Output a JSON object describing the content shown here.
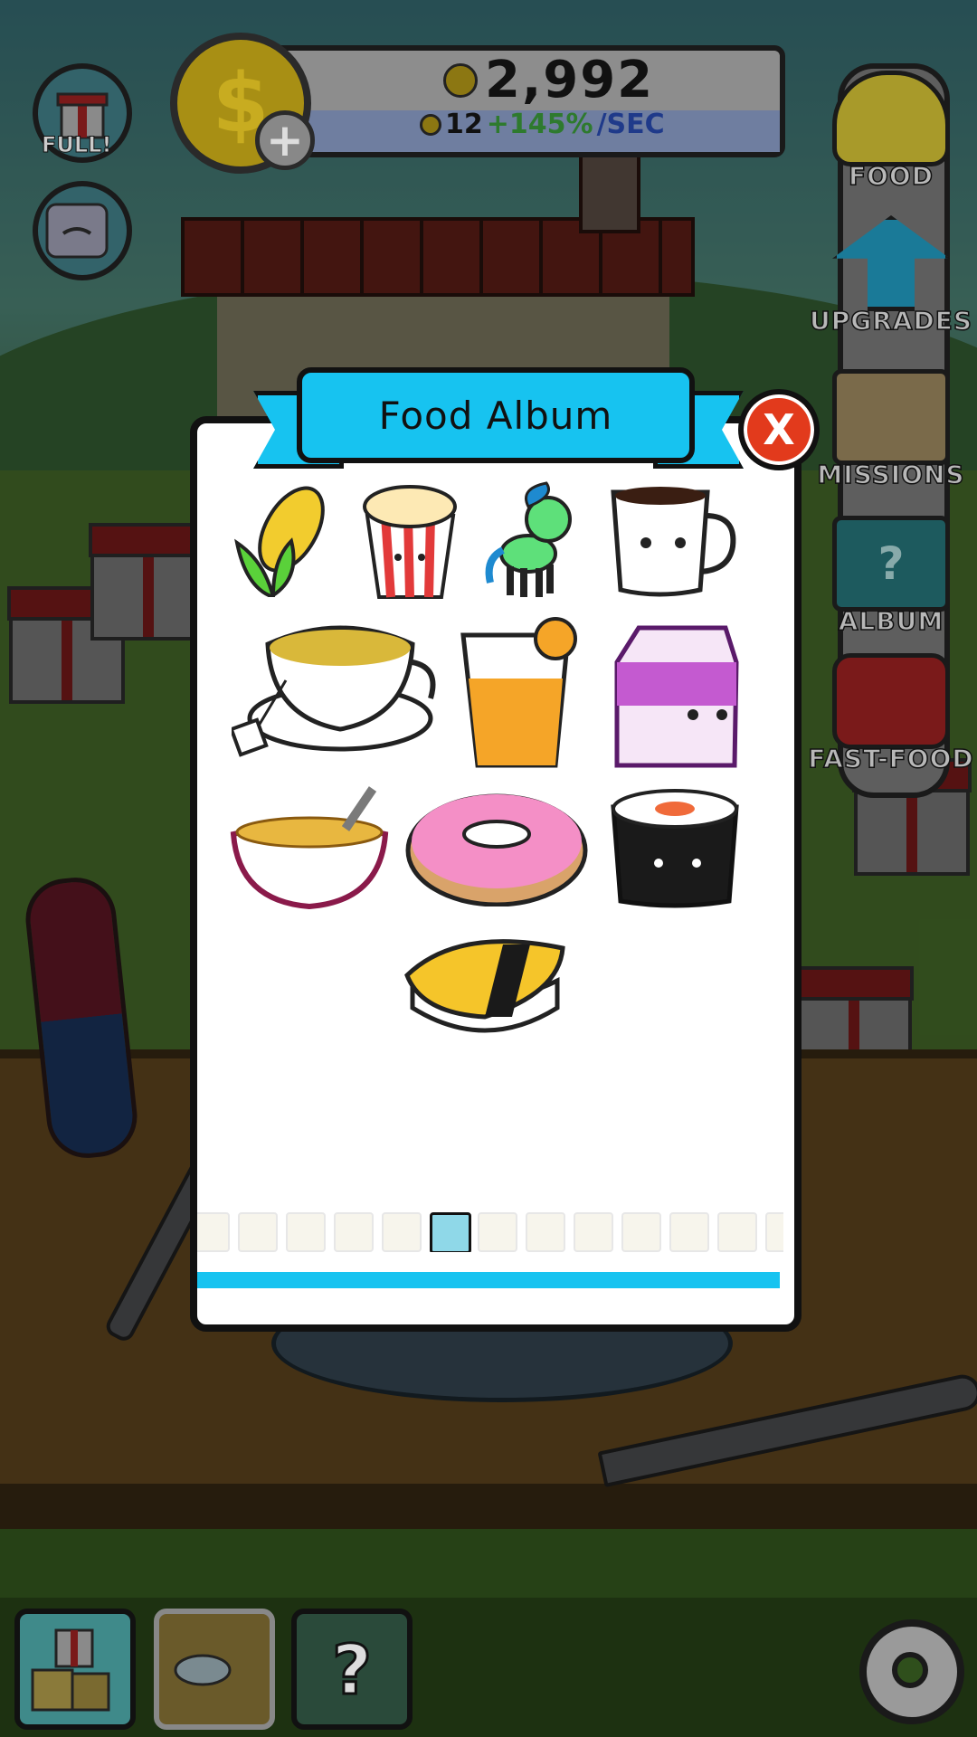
{
  "hud": {
    "coin_total": "2,992",
    "rate_amount": "12",
    "rate_percent": "+145%",
    "rate_unit": "/SEC",
    "gift_label": "FULL!"
  },
  "side_menu": [
    {
      "label": "FOOD",
      "icon": "taco-icon"
    },
    {
      "label": "UPGRADES",
      "icon": "upgrade-arrow-icon"
    },
    {
      "label": "MISSIONS",
      "icon": "clipboard-icon"
    },
    {
      "label": "ALBUM",
      "icon": "album-book-icon"
    },
    {
      "label": "FAST-FOOD",
      "icon": "fast-food-truck-icon"
    }
  ],
  "modal": {
    "title": "Food Album",
    "close_label": "X",
    "foods": [
      {
        "name": "corn",
        "icon": "corn-icon"
      },
      {
        "name": "popcorn",
        "icon": "popcorn-icon"
      },
      {
        "name": "unicorn",
        "icon": "unicorn-icon"
      },
      {
        "name": "coffee",
        "icon": "coffee-cup-icon"
      },
      {
        "name": "tea",
        "icon": "tea-cup-icon"
      },
      {
        "name": "orange juice",
        "icon": "orange-juice-icon"
      },
      {
        "name": "milk",
        "icon": "milk-carton-icon"
      },
      {
        "name": "cereal",
        "icon": "cereal-bowl-icon"
      },
      {
        "name": "donut",
        "icon": "donut-icon"
      },
      {
        "name": "sushi roll",
        "icon": "sushi-roll-icon"
      },
      {
        "name": "tamago nigiri",
        "icon": "tamago-nigiri-icon"
      }
    ],
    "page_count": 13,
    "active_page": 6
  },
  "colors": {
    "ribbon": "#17c3f0",
    "close": "#e23a1c",
    "rate_percent": "#2e7a2e",
    "rate_unit": "#1f3a8a"
  },
  "bottom_bar": [
    {
      "icon": "gift-crates-icon"
    },
    {
      "icon": "table-scene-icon"
    },
    {
      "icon": "mystery-question-icon"
    },
    {
      "icon": "settings-gear-icon"
    }
  ]
}
